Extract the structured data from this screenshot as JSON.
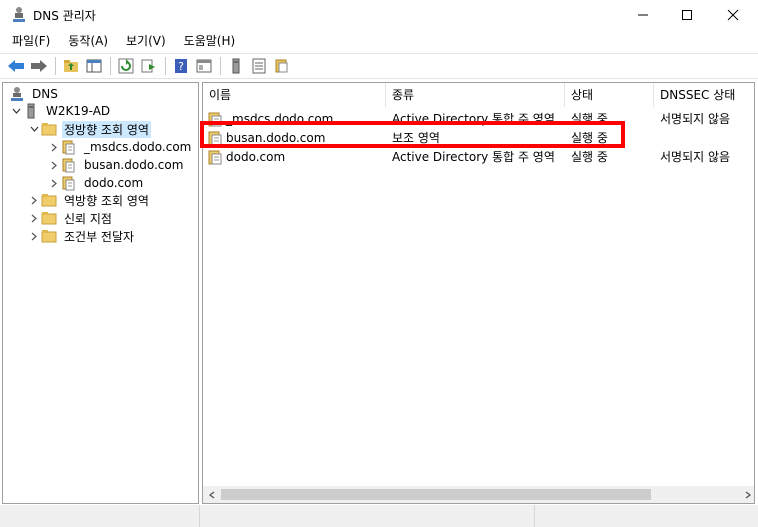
{
  "window": {
    "title": "DNS 관리자"
  },
  "menu": [
    {
      "label": "파일(F)"
    },
    {
      "label": "동작(A)"
    },
    {
      "label": "보기(V)"
    },
    {
      "label": "도움말(H)"
    }
  ],
  "toolbar": {
    "icons": [
      "back-icon",
      "forward-icon",
      "up-folder-icon",
      "show-tree-icon",
      "refresh-icon",
      "export-icon",
      "help-icon",
      "properties-icon",
      "server-icon",
      "list-icon",
      "zone-icon"
    ]
  },
  "tree": {
    "root": "DNS",
    "server": "W2K19-AD",
    "forward_zone": "정방향 조회 영역",
    "zones": [
      "_msdcs.dodo.com",
      "busan.dodo.com",
      "dodo.com"
    ],
    "reverse_zone": "역방향 조회 영역",
    "trust_points": "신뢰 지점",
    "conditional_forwarders": "조건부 전달자"
  },
  "list": {
    "columns": [
      "이름",
      "종류",
      "상태",
      "DNSSEC 상태"
    ],
    "rows": [
      {
        "name": "_msdcs.dodo.com",
        "type": "Active Directory 통합 주 영역",
        "status": "실행 중",
        "dnssec": "서명되지 않음"
      },
      {
        "name": "busan.dodo.com",
        "type": "보조 영역",
        "status": "실행 중",
        "dnssec": ""
      },
      {
        "name": "dodo.com",
        "type": "Active Directory 통합 주 영역",
        "status": "실행 중",
        "dnssec": "서명되지 않음"
      }
    ]
  },
  "colors": {
    "highlight": "#ff0000",
    "selection": "#cce8ff"
  }
}
